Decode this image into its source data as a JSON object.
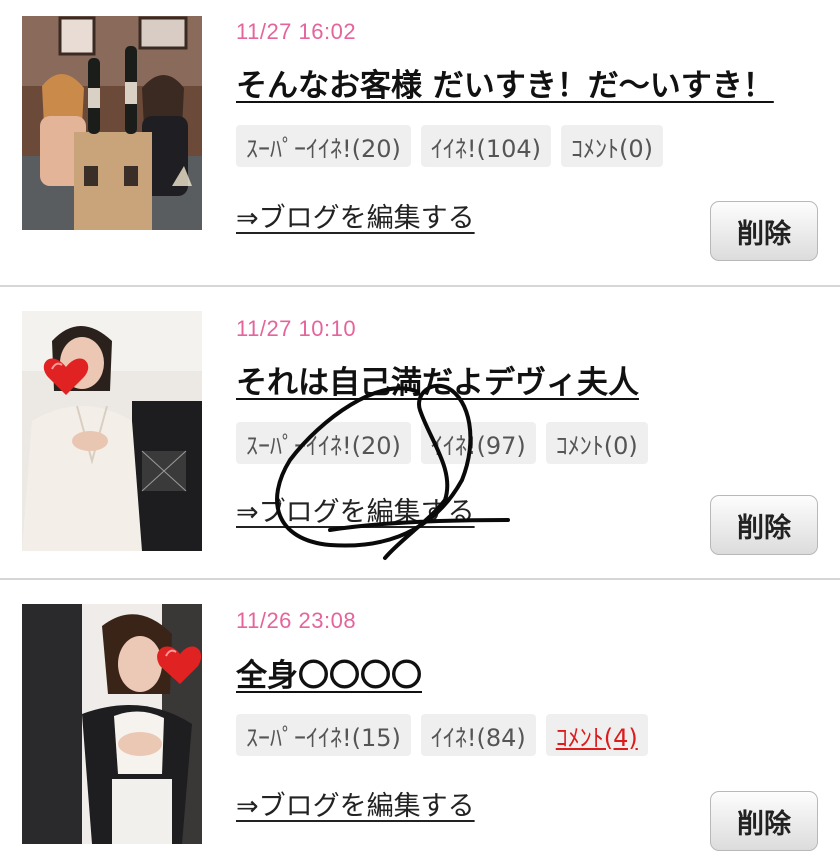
{
  "posts": [
    {
      "date": "11/27 16:02",
      "title": "そんなお客様 だいすき！だ〜いすき！",
      "super_like": "ｽｰﾊﾟｰｲｲﾈ!(20)",
      "like": "ｲｲﾈ!(104)",
      "comment": "ｺﾒﾝﾄ(0)",
      "edit": "⇒ブログを編集する",
      "delete": "削除"
    },
    {
      "date": "11/27 10:10",
      "title": "それは自己満だよデヴィ夫人",
      "super_like": "ｽｰﾊﾟｰｲｲﾈ!(20)",
      "like": "ｲｲﾈ!(97)",
      "comment": "ｺﾒﾝﾄ(0)",
      "edit": "⇒ブログを編集する",
      "delete": "削除"
    },
    {
      "date": "11/26 23:08",
      "title": "全身〇〇〇〇",
      "super_like": "ｽｰﾊﾟｰｲｲﾈ!(15)",
      "like": "ｲｲﾈ!(84)",
      "comment": "ｺﾒﾝﾄ(4)",
      "edit": "⇒ブログを編集する",
      "delete": "削除"
    }
  ],
  "colors": {
    "date": "#e5649b",
    "comment_link": "#dd1b1b",
    "badge_bg": "#efefef"
  }
}
